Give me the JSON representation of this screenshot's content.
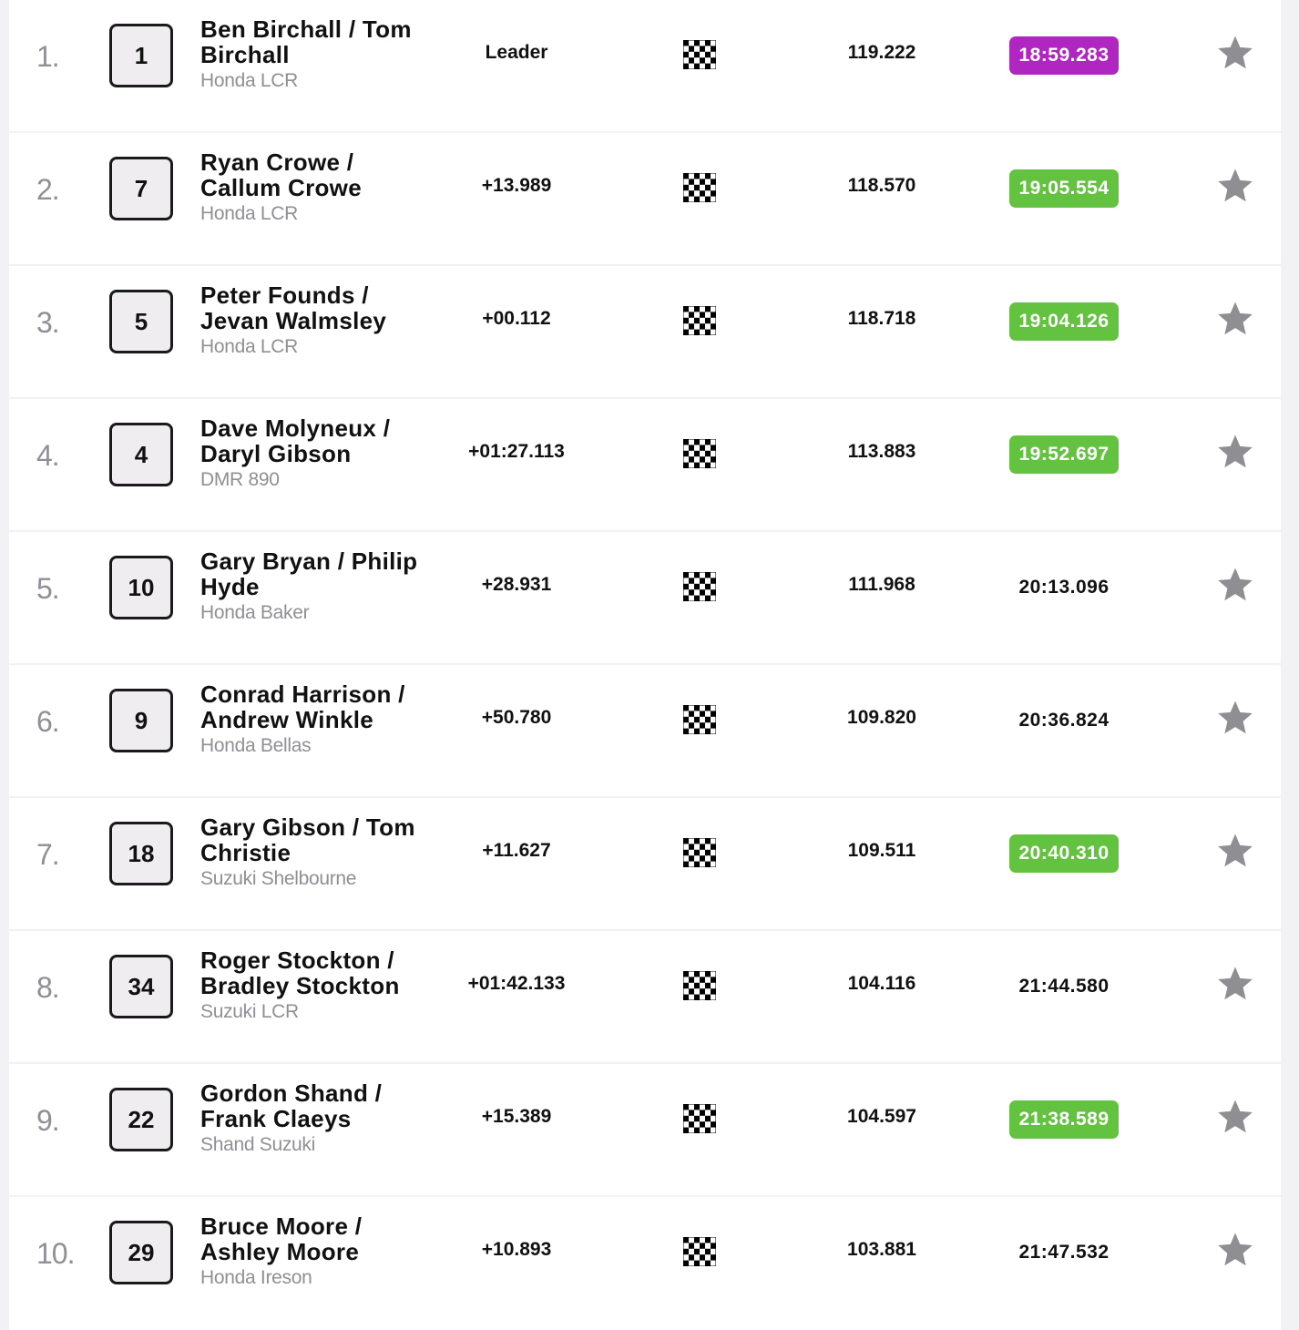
{
  "colors": {
    "fastest_lap": "#b026c0",
    "personal_best": "#63c23f",
    "position_text": "#8f8f95",
    "star": "#8e8e93"
  },
  "icons": {
    "flag": "checkered-flag-icon",
    "favourite": "star-icon"
  },
  "rows": [
    {
      "position": "1.",
      "number": "1",
      "riders": "Ben Birchall / Tom Birchall",
      "machine": "Honda LCR",
      "gap": "Leader",
      "speed": "119.222",
      "time": "18:59.283",
      "highlight": "best-overall"
    },
    {
      "position": "2.",
      "number": "7",
      "riders": "Ryan Crowe / Callum Crowe",
      "machine": "Honda LCR",
      "gap": "+13.989",
      "speed": "118.570",
      "time": "19:05.554",
      "highlight": "personal-best"
    },
    {
      "position": "3.",
      "number": "5",
      "riders": "Peter Founds / Jevan Walmsley",
      "machine": "Honda LCR",
      "gap": "+00.112",
      "speed": "118.718",
      "time": "19:04.126",
      "highlight": "personal-best"
    },
    {
      "position": "4.",
      "number": "4",
      "riders": "Dave Molyneux / Daryl Gibson",
      "machine": "DMR 890",
      "gap": "+01:27.113",
      "speed": "113.883",
      "time": "19:52.697",
      "highlight": "personal-best"
    },
    {
      "position": "5.",
      "number": "10",
      "riders": "Gary Bryan / Philip Hyde",
      "machine": "Honda Baker",
      "gap": "+28.931",
      "speed": "111.968",
      "time": "20:13.096",
      "highlight": "none"
    },
    {
      "position": "6.",
      "number": "9",
      "riders": "Conrad Harrison / Andrew Winkle",
      "machine": "Honda Bellas",
      "gap": "+50.780",
      "speed": "109.820",
      "time": "20:36.824",
      "highlight": "none"
    },
    {
      "position": "7.",
      "number": "18",
      "riders": "Gary Gibson / Tom Christie",
      "machine": "Suzuki Shelbourne",
      "gap": "+11.627",
      "speed": "109.511",
      "time": "20:40.310",
      "highlight": "personal-best"
    },
    {
      "position": "8.",
      "number": "34",
      "riders": "Roger Stockton / Bradley Stockton",
      "machine": "Suzuki LCR",
      "gap": "+01:42.133",
      "speed": "104.116",
      "time": "21:44.580",
      "highlight": "none"
    },
    {
      "position": "9.",
      "number": "22",
      "riders": "Gordon Shand / Frank Claeys",
      "machine": "Shand Suzuki",
      "gap": "+15.389",
      "speed": "104.597",
      "time": "21:38.589",
      "highlight": "personal-best"
    },
    {
      "position": "10.",
      "number": "29",
      "riders": "Bruce Moore / Ashley Moore",
      "machine": "Honda Ireson",
      "gap": "+10.893",
      "speed": "103.881",
      "time": "21:47.532",
      "highlight": "none"
    }
  ]
}
